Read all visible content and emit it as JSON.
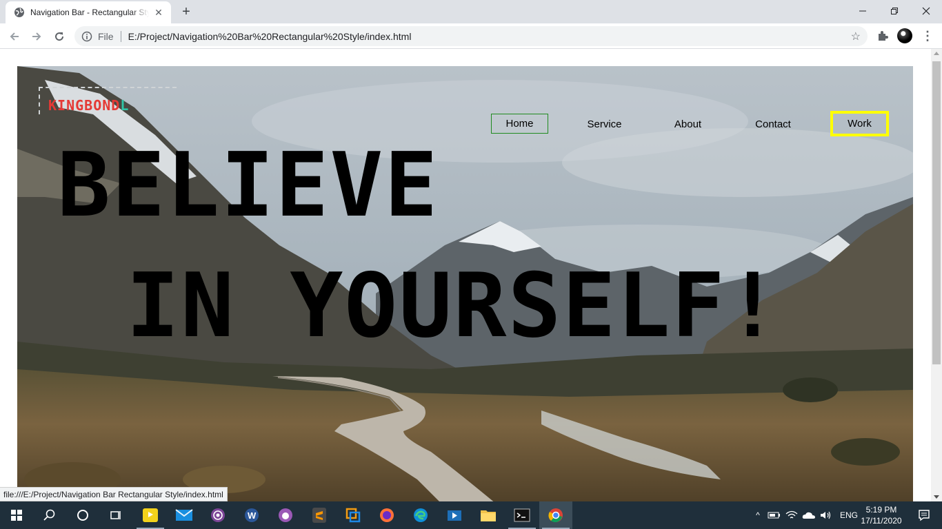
{
  "browser": {
    "tab_title": "Navigation Bar - Rectangular Style",
    "new_tab_symbol": "+",
    "url_scheme": "File",
    "url": "E:/Project/Navigation%20Bar%20Rectangular%20Style/index.html",
    "status_url": "file:///E:/Project/Navigation Bar Rectangular Style/index.html"
  },
  "page": {
    "logo": {
      "main": "KINGBOND",
      "accent": "L",
      "main_color": "#e53935",
      "accent_color": "#2fc7a8"
    },
    "nav": {
      "items": [
        {
          "label": "Home",
          "state": "active-green-border"
        },
        {
          "label": "Service"
        },
        {
          "label": "About"
        },
        {
          "label": "Contact"
        },
        {
          "label": "Work",
          "state": "highlighted-yellow-border"
        }
      ],
      "home_border_color": "#1e8a1e",
      "work_border_color": "#ffff00"
    },
    "headline_line1": "BELIEVE",
    "headline_line2": "IN YOURSELF!"
  },
  "taskbar": {
    "apps": [
      "start-icon",
      "search-icon",
      "cortana-icon",
      "task-view-icon",
      "player-icon",
      "mail-icon",
      "tor-icon",
      "word-icon",
      "github-icon",
      "sublime-icon",
      "vmware-icon",
      "firefox-icon",
      "edge-icon",
      "media-icon",
      "explorer-icon",
      "terminal-icon",
      "chrome-icon"
    ],
    "language": "ENG",
    "time": "5:19 PM",
    "date": "17/11/2020"
  }
}
